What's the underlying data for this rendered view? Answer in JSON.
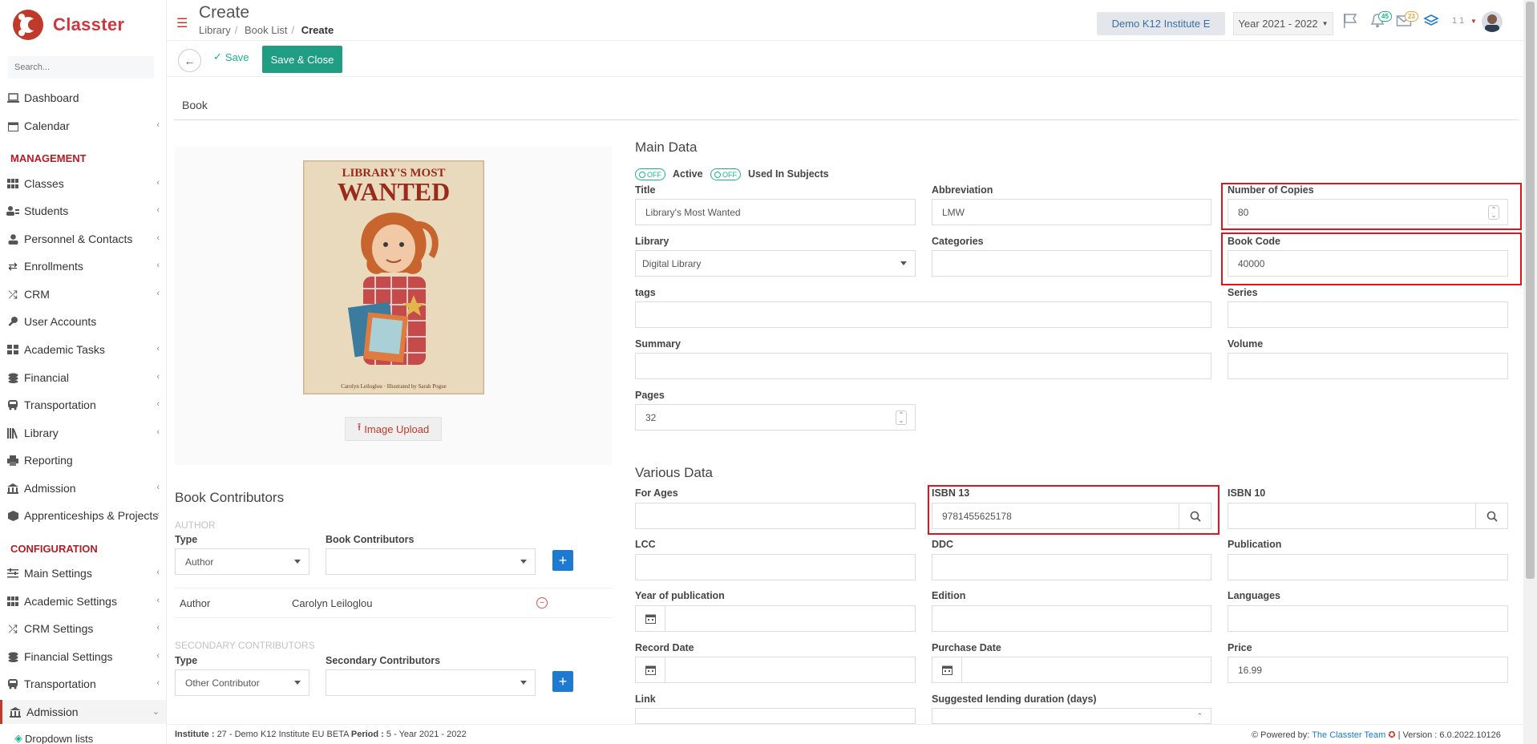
{
  "app": {
    "name": "Classter",
    "search_placeholder": "Search..."
  },
  "sidebar": {
    "items": [
      {
        "label": "Dashboard"
      },
      {
        "label": "Calendar"
      },
      {
        "label": "Classes"
      },
      {
        "label": "Students"
      },
      {
        "label": "Personnel & Contacts"
      },
      {
        "label": "Enrollments"
      },
      {
        "label": "CRM"
      },
      {
        "label": "User Accounts"
      },
      {
        "label": "Academic Tasks"
      },
      {
        "label": "Financial"
      },
      {
        "label": "Transportation"
      },
      {
        "label": "Library"
      },
      {
        "label": "Reporting"
      },
      {
        "label": "Admission"
      },
      {
        "label": "Apprenticeships & Projects"
      },
      {
        "label": "Main Settings"
      },
      {
        "label": "Academic Settings"
      },
      {
        "label": "CRM Settings"
      },
      {
        "label": "Financial Settings"
      },
      {
        "label": "Transportation"
      },
      {
        "label": "Admission"
      },
      {
        "label": "Dropdown lists"
      }
    ],
    "sections": {
      "management": "MANAGEMENT",
      "configuration": "CONFIGURATION"
    }
  },
  "header": {
    "title": "Create",
    "breadcrumb": [
      "Library",
      "Book List",
      "Create"
    ],
    "institute": "Demo K12 Institute E",
    "year": "Year 2021 - 2022",
    "notifications_count": "45",
    "messages_count": "23",
    "user_label": "1 1"
  },
  "toolbar": {
    "save_label": "Save",
    "save_close_label": "Save & Close"
  },
  "tab": {
    "label": "Book"
  },
  "cover": {
    "title_line1": "LIBRARY'S MOST",
    "title_line2": "WANTED",
    "byline": "Carolyn Leiloglou · Illustrated by Sarah Pogue"
  },
  "upload": {
    "label": "Image Upload"
  },
  "contributors": {
    "title": "Book Contributors",
    "author_section": "AUTHOR",
    "type_label": "Type",
    "book_contributors_label": "Book Contributors",
    "author_type_value": "Author",
    "author_row": {
      "type": "Author",
      "name": "Carolyn Leiloglou"
    },
    "secondary_section": "SECONDARY CONTRIBUTORS",
    "secondary_type_label": "Type",
    "secondary_contributors_label": "Secondary Contributors",
    "secondary_type_value": "Other Contributor"
  },
  "main_data": {
    "title": "Main Data",
    "toggle_off": "OFF",
    "active_label": "Active",
    "used_in_subjects_label": "Used In Subjects",
    "fields": {
      "title": {
        "label": "Title",
        "value": "Library's Most Wanted"
      },
      "abbreviation": {
        "label": "Abbreviation",
        "value": "LMW"
      },
      "copies": {
        "label": "Number of Copies",
        "value": "80"
      },
      "library": {
        "label": "Library",
        "value": "Digital Library"
      },
      "categories": {
        "label": "Categories",
        "value": ""
      },
      "book_code": {
        "label": "Book Code",
        "value": "40000"
      },
      "tags": {
        "label": "tags",
        "value": ""
      },
      "series": {
        "label": "Series",
        "value": ""
      },
      "summary": {
        "label": "Summary",
        "value": ""
      },
      "volume": {
        "label": "Volume",
        "value": ""
      },
      "pages": {
        "label": "Pages",
        "value": "32"
      }
    }
  },
  "various_data": {
    "title": "Various Data",
    "fields": {
      "for_ages": {
        "label": "For Ages",
        "value": ""
      },
      "isbn13": {
        "label": "ISBN 13",
        "value": "9781455625178"
      },
      "isbn10": {
        "label": "ISBN 10",
        "value": ""
      },
      "lcc": {
        "label": "LCC",
        "value": ""
      },
      "ddc": {
        "label": "DDC",
        "value": ""
      },
      "publication": {
        "label": "Publication",
        "value": ""
      },
      "year_pub": {
        "label": "Year of publication",
        "value": ""
      },
      "edition": {
        "label": "Edition",
        "value": ""
      },
      "languages": {
        "label": "Languages",
        "value": ""
      },
      "record_date": {
        "label": "Record Date",
        "value": ""
      },
      "purchase_date": {
        "label": "Purchase Date",
        "value": ""
      },
      "price": {
        "label": "Price",
        "value": "16.99"
      },
      "link": {
        "label": "Link",
        "value": ""
      },
      "lending": {
        "label": "Suggested lending duration (days)",
        "value": ""
      }
    }
  },
  "footer": {
    "institute_label": "Institute :",
    "institute_value": "27 - Demo K12 Institute EU BETA",
    "period_label": "Period :",
    "period_value": "5 - Year 2021 - 2022",
    "powered_by": "Powered by:",
    "team": "The Classter Team",
    "version": "| Version : 6.0.2022.10126"
  },
  "colors": {
    "brand": "#c0392b",
    "accent": "#1f9e84",
    "highlight": "#e0141e",
    "primary": "#1c7ad0"
  }
}
